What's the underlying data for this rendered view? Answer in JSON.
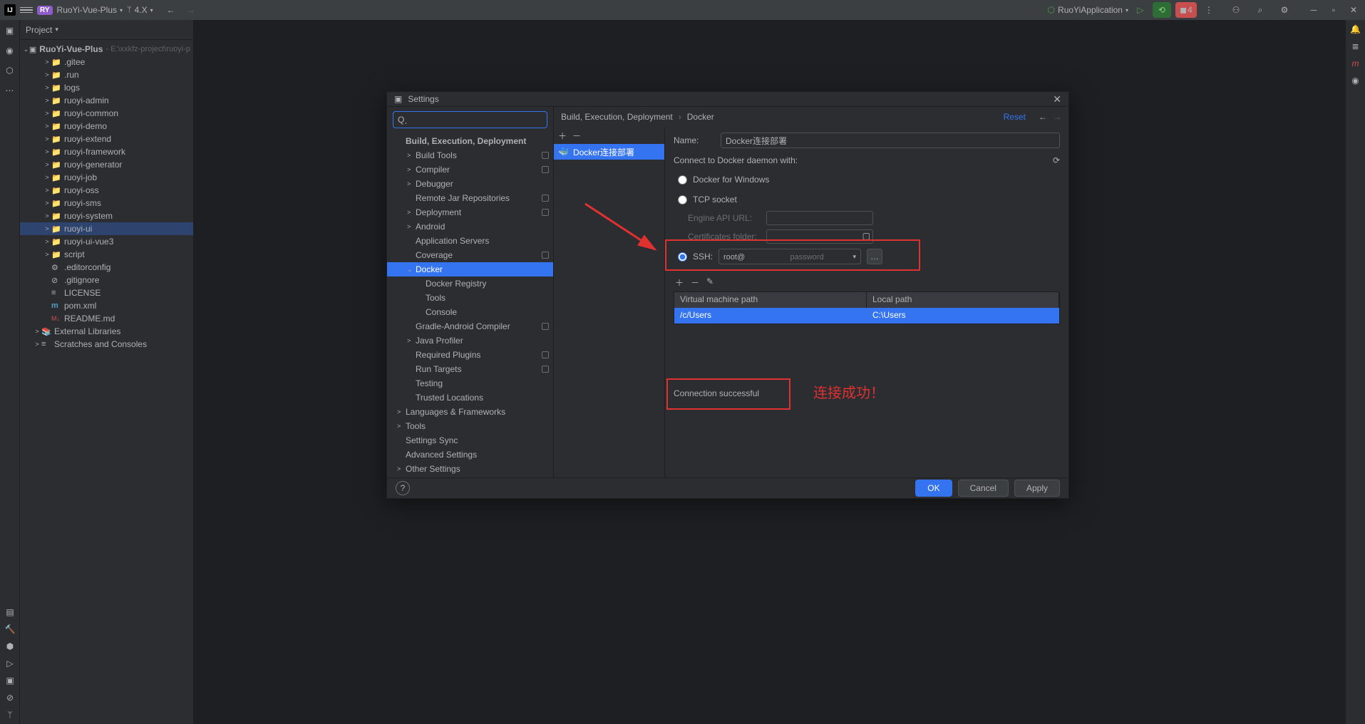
{
  "titlebar": {
    "project_badge": "RY",
    "project_name": "RuoYi-Vue-Plus",
    "branch": "4.X",
    "run_config": "RuoYiApplication",
    "stop_count": "4"
  },
  "project_panel": {
    "title": "Project",
    "root_name": "RuoYi-Vue-Plus",
    "root_path": "- E:\\xxkfz-project\\ruoyi-p",
    "nodes": [
      {
        "indent": 1,
        "arrow": ">",
        "icon": "📁",
        "name": ".gitee"
      },
      {
        "indent": 1,
        "arrow": ">",
        "icon": "📁",
        "name": ".run"
      },
      {
        "indent": 1,
        "arrow": ">",
        "icon": "📁",
        "name": "logs"
      },
      {
        "indent": 1,
        "arrow": ">",
        "icon": "📁",
        "name": "ruoyi-admin",
        "mod": true
      },
      {
        "indent": 1,
        "arrow": ">",
        "icon": "📁",
        "name": "ruoyi-common",
        "mod": true
      },
      {
        "indent": 1,
        "arrow": ">",
        "icon": "📁",
        "name": "ruoyi-demo",
        "mod": true
      },
      {
        "indent": 1,
        "arrow": ">",
        "icon": "📁",
        "name": "ruoyi-extend",
        "mod": true
      },
      {
        "indent": 1,
        "arrow": ">",
        "icon": "📁",
        "name": "ruoyi-framework",
        "mod": true
      },
      {
        "indent": 1,
        "arrow": ">",
        "icon": "📁",
        "name": "ruoyi-generator",
        "mod": true
      },
      {
        "indent": 1,
        "arrow": ">",
        "icon": "📁",
        "name": "ruoyi-job",
        "mod": true
      },
      {
        "indent": 1,
        "arrow": ">",
        "icon": "📁",
        "name": "ruoyi-oss",
        "mod": true
      },
      {
        "indent": 1,
        "arrow": ">",
        "icon": "📁",
        "name": "ruoyi-sms",
        "mod": true
      },
      {
        "indent": 1,
        "arrow": ">",
        "icon": "📁",
        "name": "ruoyi-system",
        "mod": true
      },
      {
        "indent": 1,
        "arrow": ">",
        "icon": "📁",
        "name": "ruoyi-ui",
        "selected": true
      },
      {
        "indent": 1,
        "arrow": ">",
        "icon": "📁",
        "name": "ruoyi-ui-vue3",
        "mod": true
      },
      {
        "indent": 1,
        "arrow": ">",
        "icon": "📁",
        "name": "script"
      },
      {
        "indent": 1,
        "arrow": "",
        "icon": "⚙",
        "name": ".editorconfig"
      },
      {
        "indent": 1,
        "arrow": "",
        "icon": "⊘",
        "name": ".gitignore"
      },
      {
        "indent": 1,
        "arrow": "",
        "icon": "≡",
        "name": "LICENSE"
      },
      {
        "indent": 1,
        "arrow": "",
        "icon": "m",
        "name": "pom.xml",
        "pom": true
      },
      {
        "indent": 1,
        "arrow": "",
        "icon": "M↓",
        "name": "README.md",
        "md": true
      },
      {
        "indent": 0,
        "arrow": ">",
        "icon": "📚",
        "name": "External Libraries",
        "root": true
      },
      {
        "indent": 0,
        "arrow": ">",
        "icon": "≡",
        "name": "Scratches and Consoles",
        "root": true
      }
    ]
  },
  "dialog": {
    "title": "Settings",
    "breadcrumb": [
      "Build, Execution, Deployment",
      "Docker"
    ],
    "reset": "Reset",
    "search_placeholder": "",
    "tree": [
      {
        "name": "Build, Execution, Deployment",
        "indent": 0,
        "cat": true
      },
      {
        "name": "Build Tools",
        "indent": 1,
        "arrow": ">",
        "badge": true
      },
      {
        "name": "Compiler",
        "indent": 1,
        "arrow": ">",
        "badge": true
      },
      {
        "name": "Debugger",
        "indent": 1,
        "arrow": ">"
      },
      {
        "name": "Remote Jar Repositories",
        "indent": 1,
        "badge": true
      },
      {
        "name": "Deployment",
        "indent": 1,
        "arrow": ">",
        "badge": true
      },
      {
        "name": "Android",
        "indent": 1,
        "arrow": ">"
      },
      {
        "name": "Application Servers",
        "indent": 1
      },
      {
        "name": "Coverage",
        "indent": 1,
        "badge": true
      },
      {
        "name": "Docker",
        "indent": 1,
        "arrow": "v",
        "selected": true
      },
      {
        "name": "Docker Registry",
        "indent": 2
      },
      {
        "name": "Tools",
        "indent": 2
      },
      {
        "name": "Console",
        "indent": 2
      },
      {
        "name": "Gradle-Android Compiler",
        "indent": 1,
        "badge": true
      },
      {
        "name": "Java Profiler",
        "indent": 1,
        "arrow": ">"
      },
      {
        "name": "Required Plugins",
        "indent": 1,
        "badge": true
      },
      {
        "name": "Run Targets",
        "indent": 1,
        "badge": true
      },
      {
        "name": "Testing",
        "indent": 1
      },
      {
        "name": "Trusted Locations",
        "indent": 1
      },
      {
        "name": "Languages & Frameworks",
        "indent": 0,
        "arrow": ">"
      },
      {
        "name": "Tools",
        "indent": 0,
        "arrow": ">"
      },
      {
        "name": "Settings Sync",
        "indent": 0
      },
      {
        "name": "Advanced Settings",
        "indent": 0
      },
      {
        "name": "Other Settings",
        "indent": 0,
        "arrow": ">"
      }
    ],
    "docker": {
      "list_item": "Docker连接部署",
      "name_label": "Name:",
      "name_value": "Docker连接部署",
      "connect_label": "Connect to Docker daemon with:",
      "radio_windows": "Docker for Windows",
      "radio_tcp": "TCP socket",
      "engine_api_label": "Engine API URL:",
      "engine_api_value": "",
      "cert_label": "Certificates folder:",
      "cert_value": "",
      "radio_ssh": "SSH:",
      "ssh_value": "root@",
      "ssh_placeholder": "password",
      "path_headers": [
        "Virtual machine path",
        "Local path"
      ],
      "path_row": [
        "/c/Users",
        "C:\\Users"
      ],
      "connection_status": "Connection successful"
    },
    "annotation": "连接成功！",
    "footer": {
      "ok": "OK",
      "cancel": "Cancel",
      "apply": "Apply"
    }
  }
}
